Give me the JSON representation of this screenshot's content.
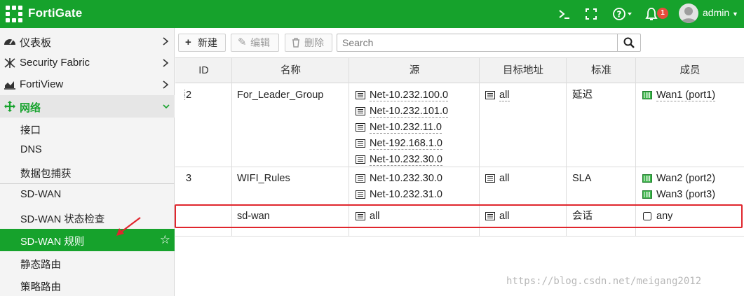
{
  "header": {
    "brand": "FortiGate",
    "icons": [
      "console-icon",
      "fullscreen-icon",
      "help-icon",
      "notifications-icon"
    ],
    "notification_count": "1",
    "user": "admin",
    "color": "#16a22c"
  },
  "sidebar": {
    "top_items": [
      {
        "label": "仪表板",
        "icon": "dashboard-icon"
      },
      {
        "label": "Security Fabric",
        "icon": "fabric-icon"
      },
      {
        "label": "FortiView",
        "icon": "chart-icon"
      },
      {
        "label": "网络",
        "icon": "network-icon"
      }
    ],
    "sub_items": [
      {
        "label": "接口"
      },
      {
        "label": "DNS"
      },
      {
        "label": "数据包捕获"
      },
      {
        "label": "SD-WAN"
      },
      {
        "label": "SD-WAN 状态检查"
      },
      {
        "label": "SD-WAN 规则"
      },
      {
        "label": "静态路由"
      },
      {
        "label": "策略路由"
      }
    ]
  },
  "toolbar": {
    "new_label": "新建",
    "edit_label": "编辑",
    "delete_label": "删除",
    "search_placeholder": "Search"
  },
  "table": {
    "columns": [
      "ID",
      "名称",
      "源",
      "目标地址",
      "标准",
      "成员"
    ],
    "rows": [
      {
        "id": "2",
        "name": "For_Leader_Group",
        "source": [
          "Net-10.232.100.0",
          "Net-10.232.101.0",
          "Net-10.232.11.0",
          "Net-192.168.1.0",
          "Net-10.232.30.0"
        ],
        "destination": [
          "all"
        ],
        "criteria": "延迟",
        "members": [
          "Wan1 (port1)"
        ]
      },
      {
        "id": "3",
        "name": "WIFI_Rules",
        "source": [
          "Net-10.232.30.0",
          "Net-10.232.31.0"
        ],
        "destination": [
          "all"
        ],
        "criteria": "SLA",
        "members": [
          "Wan2 (port2)",
          "Wan3 (port3)"
        ]
      },
      {
        "id": "",
        "name": "sd-wan",
        "source": [
          "all"
        ],
        "destination": [
          "all"
        ],
        "criteria": "会话",
        "members": [
          "any"
        ]
      }
    ]
  },
  "watermark": "https://blog.csdn.net/meigang2012"
}
